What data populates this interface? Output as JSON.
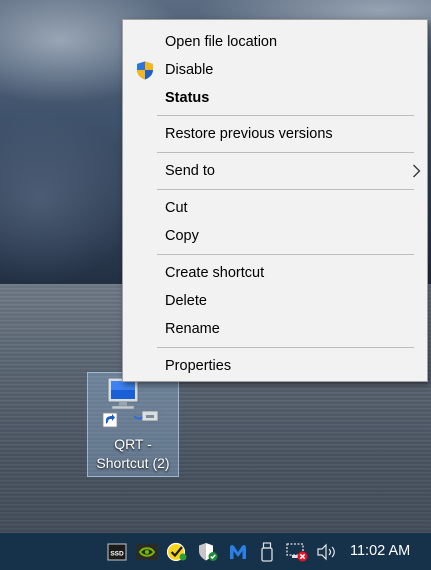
{
  "desktop_icon": {
    "label_line1": "QRT -",
    "label_line2": "Shortcut (2)",
    "icon": "computer-network-icon"
  },
  "context_menu": {
    "items": [
      {
        "label": "Open file location"
      },
      {
        "label": "Disable",
        "icon": "uac-shield-icon"
      },
      {
        "label": "Status",
        "bold": true
      },
      {
        "label": "Restore previous versions"
      },
      {
        "label": "Send to",
        "submenu": true
      },
      {
        "label": "Cut"
      },
      {
        "label": "Copy"
      },
      {
        "label": "Create shortcut"
      },
      {
        "label": "Delete"
      },
      {
        "label": "Rename"
      },
      {
        "label": "Properties"
      }
    ]
  },
  "taskbar": {
    "tray_icons": [
      "ssd-icon",
      "nvidia-icon",
      "norton-check-icon",
      "security-shield-icon",
      "malwarebytes-icon",
      "usb-drive-icon",
      "network-disconnected-icon",
      "volume-icon"
    ],
    "ssd_text": "SSD",
    "clock": "11:02 AM"
  },
  "colors": {
    "menu_bg": "#f2f2f2",
    "taskbar_bg": "#16324b",
    "selection": "#a0c8f0"
  }
}
